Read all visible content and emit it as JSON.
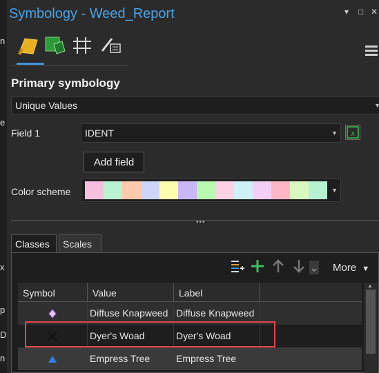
{
  "window": {
    "title": "Symbology - Weed_Report",
    "controls": [
      "▾",
      "□",
      "✕"
    ]
  },
  "left_strip_fragments": [
    "n",
    "e",
    "x",
    "p",
    "D",
    "n"
  ],
  "toolbar": {
    "tools": [
      "primary-symbology-icon",
      "vary-symbology-icon",
      "symbol-layers-icon",
      "labeling-properties-icon"
    ]
  },
  "primary": {
    "heading": "Primary symbology",
    "method": "Unique Values",
    "field1_label": "Field 1",
    "field1_value": "IDENT",
    "add_field": "Add field",
    "color_scheme_label": "Color scheme",
    "color_ramp": [
      "#f6bfe0",
      "#b9f3d2",
      "#ffc9ad",
      "#cdd6f7",
      "#fdfdb0",
      "#c8b8f8",
      "#b8f8b0",
      "#fcd2e6",
      "#cef0f6",
      "#f3cff8",
      "#fcb6c8",
      "#d9f8c0",
      "#b8f0d2"
    ]
  },
  "tabs": [
    {
      "label": "Classes",
      "active": true
    },
    {
      "label": "Scales",
      "active": false
    }
  ],
  "classes_toolbar": {
    "more": "More"
  },
  "grid": {
    "columns": [
      "Symbol",
      "Value",
      "Label"
    ],
    "rows": [
      {
        "symbol": "diamond",
        "color": "#e8c8f8",
        "value": "Diffuse Knapweed",
        "label": "Diffuse Knapweed",
        "bg": "#2f2f2f"
      },
      {
        "symbol": "x",
        "color": "#111111",
        "value": "Dyer's Woad",
        "label": "Dyer's Woad",
        "bg": "#1e1e1e"
      },
      {
        "symbol": "triangle",
        "color": "#2f7ee8",
        "value": "Empress Tree",
        "label": "Empress Tree",
        "bg": "#3a3a3a"
      }
    ]
  }
}
